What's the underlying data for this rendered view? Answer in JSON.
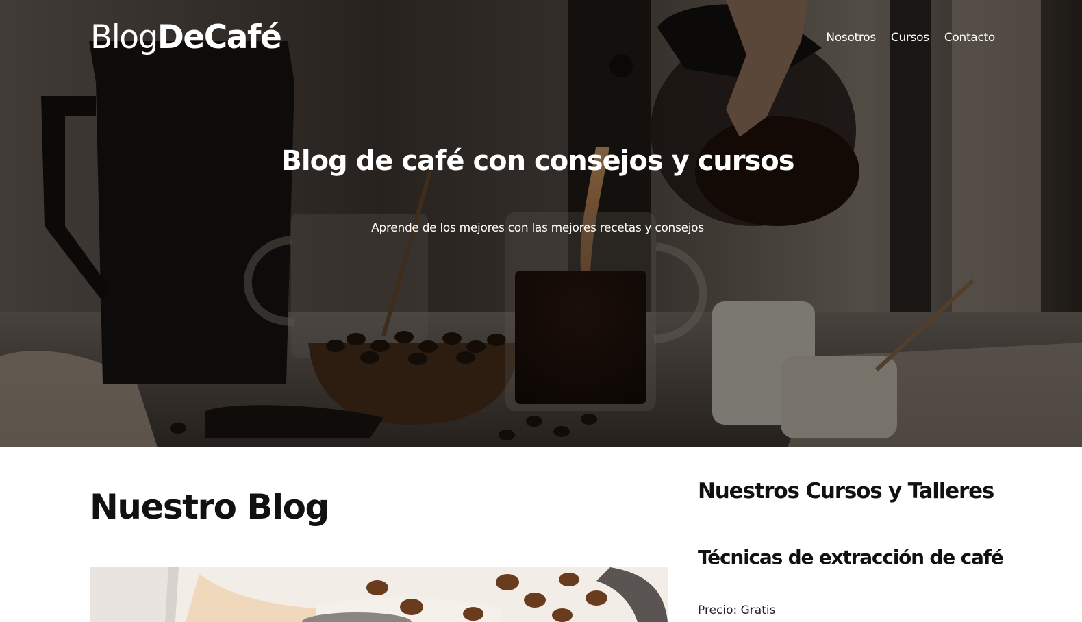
{
  "header": {
    "logo_light": "Blog",
    "logo_bold": "DeCafé",
    "nav": [
      {
        "label": "Nosotros"
      },
      {
        "label": "Cursos"
      },
      {
        "label": "Contacto"
      }
    ]
  },
  "hero": {
    "title": "Blog de café con consejos y cursos",
    "subtitle": "Aprende de los mejores con las mejores recetas y consejos",
    "image_subject": "coffee being poured from a glass carafe into glass mugs with coffee beans"
  },
  "blog": {
    "heading": "Nuestro Blog",
    "first_post_image_subject": "coffee beans and grinder"
  },
  "sidebar": {
    "heading": "Nuestros Cursos y Talleres",
    "courses": [
      {
        "title": "Técnicas de extracción de café",
        "meta": "Precio: Gratis"
      }
    ]
  },
  "colors": {
    "hero_overlay": "#0a0807",
    "text_light": "#ffffff",
    "text_dark": "#111111",
    "page_bg": "#ffffff"
  }
}
